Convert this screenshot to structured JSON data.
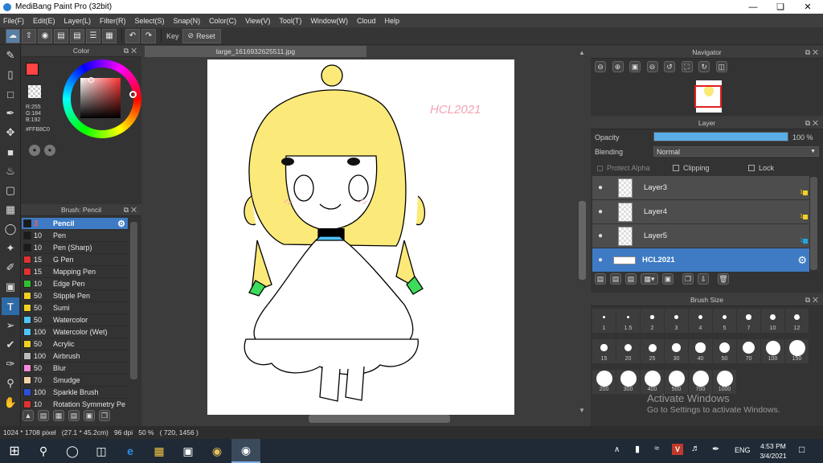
{
  "app": {
    "title": "MediBang Paint Pro (32bit)"
  },
  "menu": [
    "File(F)",
    "Edit(E)",
    "Layer(L)",
    "Filter(R)",
    "Select(S)",
    "Snap(N)",
    "Color(C)",
    "View(V)",
    "Tool(T)",
    "Window(W)",
    "Cloud",
    "Help"
  ],
  "toolbar": {
    "key_label": "Key",
    "reset_label": "Reset"
  },
  "color_panel": {
    "title": "Color",
    "r": "R:255",
    "g": "G:184",
    "b": "B:192",
    "hex": "#FFB8C0",
    "primary": "#FF4444",
    "secondary": "#000000"
  },
  "brush_panel": {
    "title": "Brush: Pencil",
    "items": [
      {
        "size": "3",
        "name": "Pencil",
        "color": "#1a1a1a",
        "selected": true
      },
      {
        "size": "10",
        "name": "Pen",
        "color": "#1a1a1a"
      },
      {
        "size": "10",
        "name": "Pen (Sharp)",
        "color": "#1a1a1a"
      },
      {
        "size": "15",
        "name": "G Pen",
        "color": "#e03030"
      },
      {
        "size": "15",
        "name": "Mapping Pen",
        "color": "#e03030"
      },
      {
        "size": "10",
        "name": "Edge Pen",
        "color": "#2fbf2f"
      },
      {
        "size": "50",
        "name": "Stipple Pen",
        "color": "#f0d020"
      },
      {
        "size": "50",
        "name": "Sumi",
        "color": "#f0d020"
      },
      {
        "size": "50",
        "name": "Watercolor",
        "color": "#4fc3f7"
      },
      {
        "size": "100",
        "name": "Watercolor (Wet)",
        "color": "#4fc3f7"
      },
      {
        "size": "50",
        "name": "Acrylic",
        "color": "#f0d020"
      },
      {
        "size": "100",
        "name": "Airbrush",
        "color": "#bbbbbb"
      },
      {
        "size": "50",
        "name": "Blur",
        "color": "#f58ad8"
      },
      {
        "size": "70",
        "name": "Smudge",
        "color": "#f5d3a8"
      },
      {
        "size": "100",
        "name": "Sparkle Brush",
        "color": "#2f4fd8"
      },
      {
        "size": "10",
        "name": "Rotation Symmetry Pe",
        "color": "#e03030"
      }
    ]
  },
  "document": {
    "tab": "large_1616932625511.jpg",
    "signature": "HCL2021"
  },
  "navigator": {
    "title": "Navigator"
  },
  "layer_panel": {
    "title": "Layer",
    "opacity_label": "Opacity",
    "opacity_value": "100 %",
    "opacity": 1.0,
    "blending_label": "Blending",
    "blending_value": "Normal",
    "protect_alpha": "Protect Alpha",
    "clipping": "Clipping",
    "lock": "Lock",
    "layers": [
      {
        "name": "Layer3",
        "num": "1",
        "swatch": "#f5d020"
      },
      {
        "name": "Layer4",
        "num": "1",
        "swatch": "#f5d020"
      },
      {
        "name": "Layer5",
        "num": "1",
        "swatch": "#1fa8e0"
      },
      {
        "name": "HCL2021",
        "selected": true
      }
    ]
  },
  "brush_size": {
    "title": "Brush Size",
    "sizes": [
      "1",
      "1.5",
      "2",
      "3",
      "4",
      "5",
      "7",
      "10",
      "12",
      "15",
      "20",
      "25",
      "30",
      "40",
      "50",
      "70",
      "100",
      "150",
      "200",
      "300",
      "400",
      "500",
      "700",
      "1000"
    ]
  },
  "watermark": {
    "line1": "Activate Windows",
    "line2": "Go to Settings to activate Windows."
  },
  "status": {
    "text": "1024 * 1708 pixel   (27.1 * 45.2cm)   96 dpi   50 %   ( 720, 1456 )"
  },
  "taskbar": {
    "language": "ENG",
    "time": "4:53 PM",
    "date": "3/4/2021"
  }
}
